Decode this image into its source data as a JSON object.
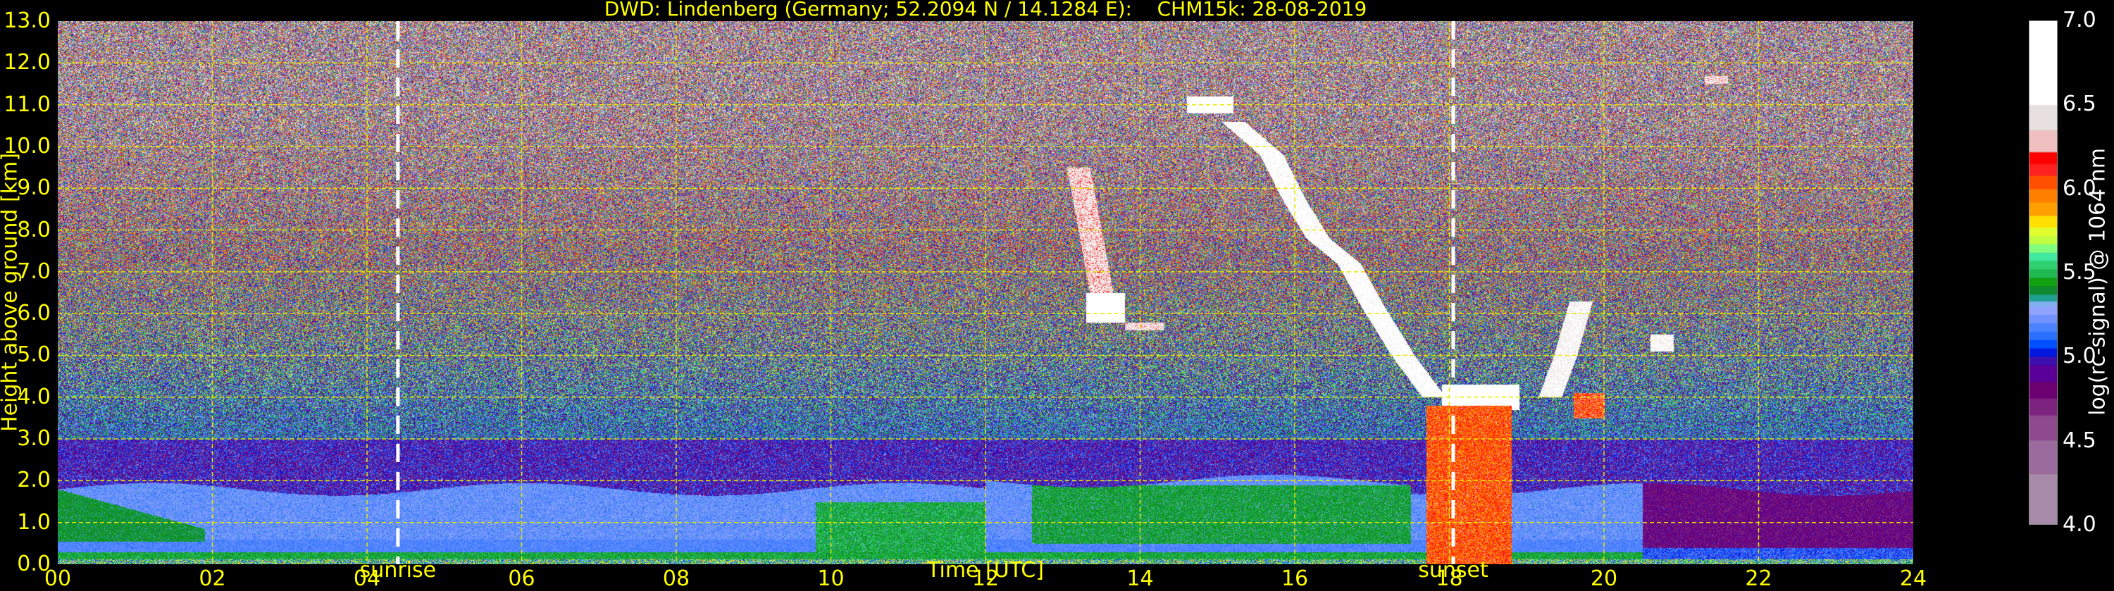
{
  "chart_data": {
    "type": "heatmap",
    "title": "DWD: Lindenberg (Germany; 52.2094 N / 14.1284 E):    CHM15k: 28-08-2019",
    "xlabel": "Time [UTC]",
    "ylabel": "Height above ground [km]",
    "xlim": [
      0,
      24
    ],
    "ylim": [
      0,
      13
    ],
    "xticks": [
      "00",
      "02",
      "04",
      "06",
      "08",
      "10",
      "12",
      "14",
      "16",
      "18",
      "20",
      "22",
      "24"
    ],
    "yticks": [
      "0.0",
      "1.0",
      "2.0",
      "3.0",
      "4.0",
      "5.0",
      "6.0",
      "7.0",
      "8.0",
      "9.0",
      "10.0",
      "11.0",
      "12.0",
      "13.0"
    ],
    "grid": true,
    "markers": [
      {
        "label": "sunrise",
        "time": 4.4
      },
      {
        "label": "sunset",
        "time": 18.05
      }
    ],
    "colorbar": {
      "label": "log(rc-signal) @ 1064 nm",
      "range": [
        4.0,
        7.0
      ],
      "ticks": [
        "4.0",
        "4.5",
        "5.0",
        "5.5",
        "6.0",
        "6.5",
        "7.0"
      ],
      "levels": [
        {
          "from": 4.0,
          "to": 4.3,
          "color": "#a78ba8"
        },
        {
          "from": 4.3,
          "to": 4.5,
          "color": "#9c6b9d"
        },
        {
          "from": 4.5,
          "to": 4.65,
          "color": "#8d4a8f"
        },
        {
          "from": 4.65,
          "to": 4.75,
          "color": "#7c2380"
        },
        {
          "from": 4.75,
          "to": 4.85,
          "color": "#6c0070"
        },
        {
          "from": 4.85,
          "to": 4.95,
          "color": "#5a0098"
        },
        {
          "from": 4.95,
          "to": 5.0,
          "color": "#3d10b0"
        },
        {
          "from": 5.0,
          "to": 5.05,
          "color": "#0018e0"
        },
        {
          "from": 5.05,
          "to": 5.1,
          "color": "#0050ff"
        },
        {
          "from": 5.1,
          "to": 5.15,
          "color": "#2a70ff"
        },
        {
          "from": 5.15,
          "to": 5.2,
          "color": "#4a82ff"
        },
        {
          "from": 5.2,
          "to": 5.25,
          "color": "#7093ff"
        },
        {
          "from": 5.25,
          "to": 5.3,
          "color": "#90a4ff"
        },
        {
          "from": 5.3,
          "to": 5.33,
          "color": "#80b0f0"
        },
        {
          "from": 5.33,
          "to": 5.37,
          "color": "#20a090"
        },
        {
          "from": 5.37,
          "to": 5.42,
          "color": "#108a30"
        },
        {
          "from": 5.42,
          "to": 5.47,
          "color": "#10a010"
        },
        {
          "from": 5.47,
          "to": 5.52,
          "color": "#20b850"
        },
        {
          "from": 5.52,
          "to": 5.57,
          "color": "#30d070"
        },
        {
          "from": 5.57,
          "to": 5.62,
          "color": "#40e8a0"
        },
        {
          "from": 5.62,
          "to": 5.67,
          "color": "#80ff80"
        },
        {
          "from": 5.67,
          "to": 5.72,
          "color": "#c0ff40"
        },
        {
          "from": 5.72,
          "to": 5.77,
          "color": "#e0ff30"
        },
        {
          "from": 5.77,
          "to": 5.84,
          "color": "#ffe000"
        },
        {
          "from": 5.84,
          "to": 5.92,
          "color": "#ffa000"
        },
        {
          "from": 5.92,
          "to": 6.0,
          "color": "#ff8000"
        },
        {
          "from": 6.0,
          "to": 6.08,
          "color": "#ff5000"
        },
        {
          "from": 6.08,
          "to": 6.15,
          "color": "#ff2020"
        },
        {
          "from": 6.15,
          "to": 6.22,
          "color": "#ff0000"
        },
        {
          "from": 6.22,
          "to": 6.35,
          "color": "#f0c0c0"
        },
        {
          "from": 6.35,
          "to": 6.5,
          "color": "#e8e0e0"
        },
        {
          "from": 6.5,
          "to": 7.0,
          "color": "#ffffff"
        }
      ]
    },
    "features": [
      {
        "t0": 14.6,
        "t1": 15.2,
        "h0": 10.8,
        "h1": 11.2,
        "value": 6.8
      },
      {
        "t0": 13.3,
        "t1": 13.8,
        "h0": 5.8,
        "h1": 6.5,
        "value": 6.8
      },
      {
        "t0": 13.8,
        "t1": 14.3,
        "h0": 5.6,
        "h1": 5.8,
        "value": 6.4
      },
      {
        "t0": 17.7,
        "t1": 18.8,
        "h0": 0.0,
        "h1": 3.8,
        "value": 6.05
      },
      {
        "t0": 17.9,
        "t1": 18.9,
        "h0": 3.7,
        "h1": 4.3,
        "value": 6.8
      },
      {
        "t0": 19.6,
        "t1": 20.0,
        "h0": 3.5,
        "h1": 4.1,
        "value": 6.1
      },
      {
        "t0": 20.6,
        "t1": 20.9,
        "h0": 5.1,
        "h1": 5.5,
        "value": 6.6
      },
      {
        "t0": 21.3,
        "t1": 21.6,
        "h0": 11.5,
        "h1": 11.7,
        "value": 6.4
      }
    ],
    "streaks": [
      {
        "points": [
          [
            15.2,
            10.6
          ],
          [
            15.7,
            9.8
          ],
          [
            16.0,
            8.7
          ],
          [
            16.3,
            7.8
          ],
          [
            16.7,
            7.2
          ],
          [
            17.0,
            6.2
          ],
          [
            17.4,
            5.0
          ],
          [
            17.8,
            4.0
          ]
        ],
        "width_km": 0.35,
        "value": 6.7
      },
      {
        "points": [
          [
            13.2,
            9.5
          ],
          [
            13.3,
            8.5
          ],
          [
            13.4,
            7.5
          ],
          [
            13.5,
            6.5
          ]
        ],
        "width_km": 0.25,
        "value": 6.4
      },
      {
        "points": [
          [
            19.3,
            4.0
          ],
          [
            19.5,
            5.0
          ],
          [
            19.7,
            6.3
          ]
        ],
        "width_km": 0.25,
        "value": 6.6
      }
    ]
  }
}
